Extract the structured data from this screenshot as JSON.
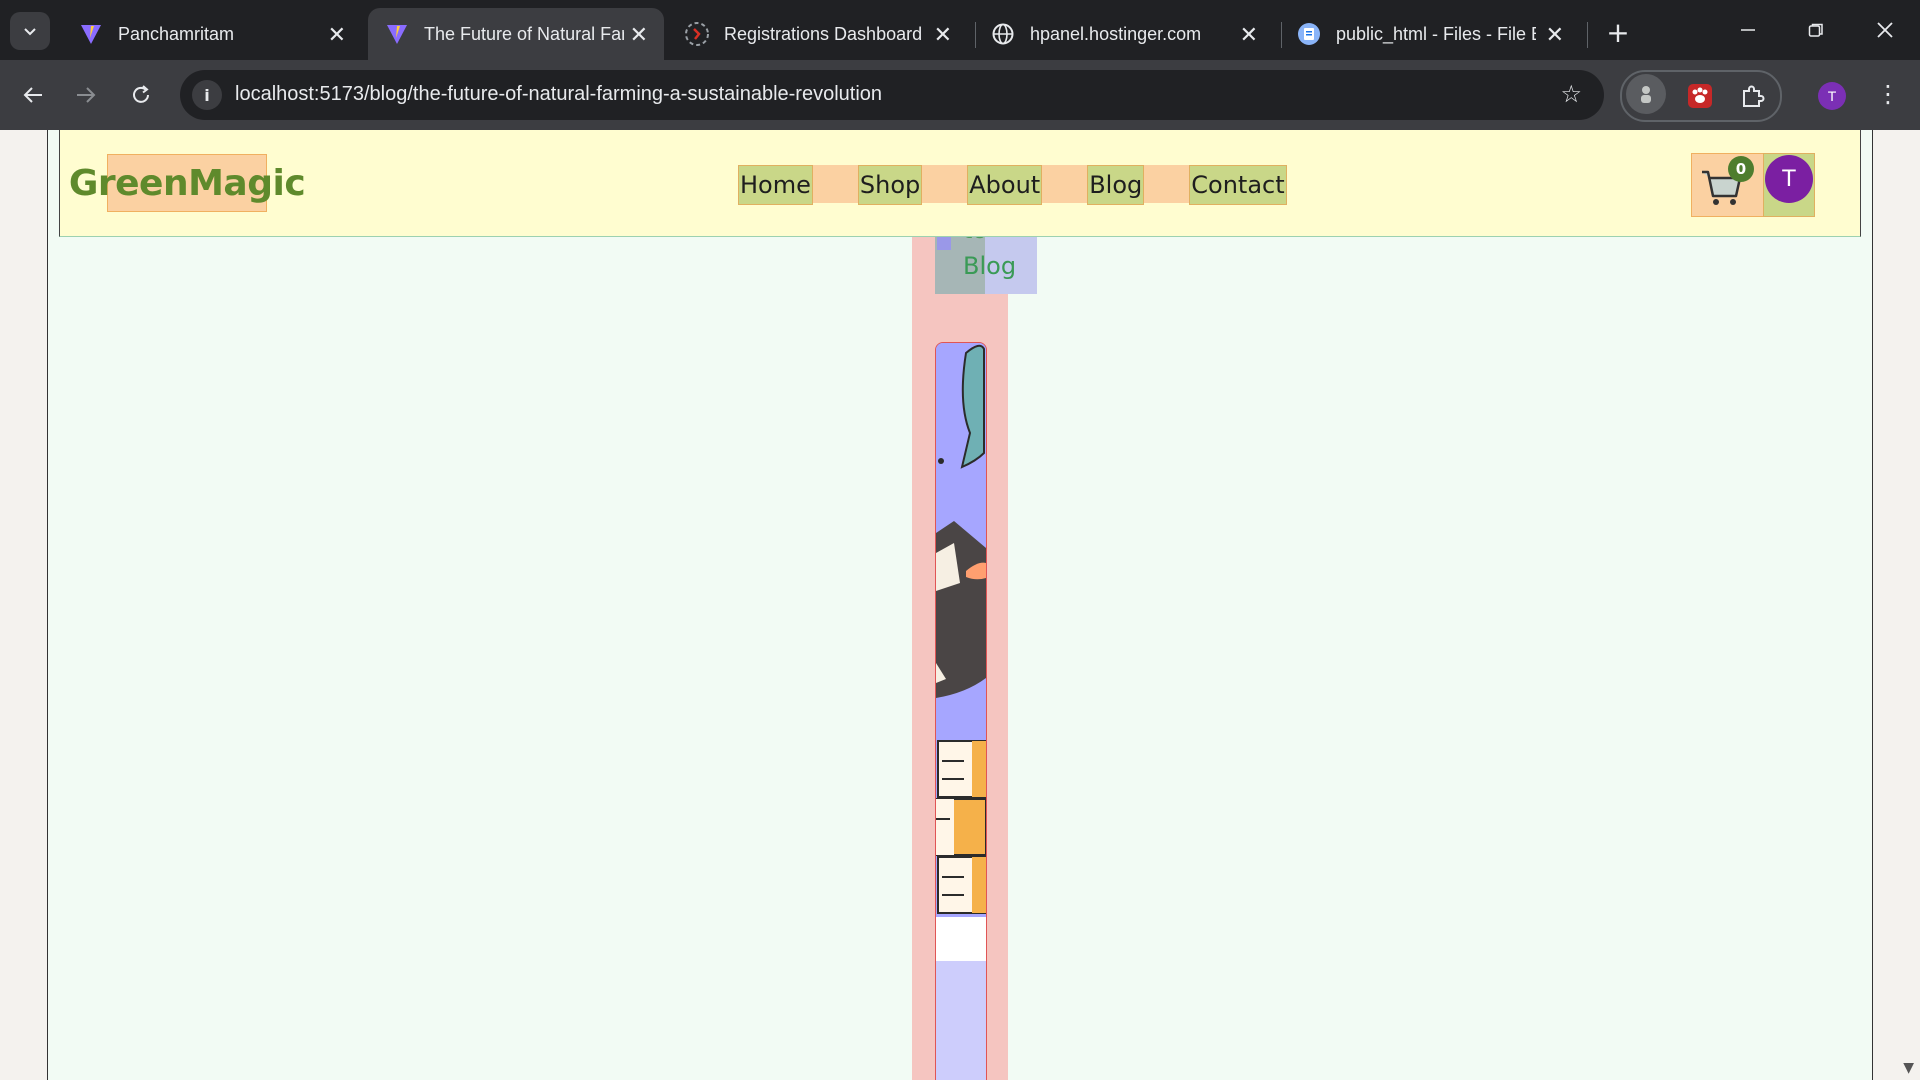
{
  "browser": {
    "tabs": [
      {
        "title": "Panchamritam",
        "icon": "vite-icon"
      },
      {
        "title": "The Future of Natural Far",
        "icon": "vite-icon",
        "active": true
      },
      {
        "title": "Registrations Dashboard",
        "icon": "registrations-icon"
      },
      {
        "title": "hpanel.hostinger.com",
        "icon": "globe-icon"
      },
      {
        "title": "public_html - Files - File E",
        "icon": "file-manager-icon"
      }
    ],
    "url": "localhost:5173/blog/the-future-of-natural-farming-a-sustainable-revolution",
    "profile_initial": "T"
  },
  "site": {
    "logo": "GreenMagic",
    "nav": [
      {
        "label": "Home"
      },
      {
        "label": "Shop"
      },
      {
        "label": "About"
      },
      {
        "label": "Blog"
      },
      {
        "label": "Contact"
      }
    ],
    "cart_count": "0",
    "user_initial": "T"
  },
  "article": {
    "back_link_partial": "to",
    "back_link_label": "Blog"
  },
  "colors": {
    "logo_green": "#5f8a2c",
    "header_bg": "#fffdd0",
    "avatar_purple": "#7b1fa2"
  }
}
